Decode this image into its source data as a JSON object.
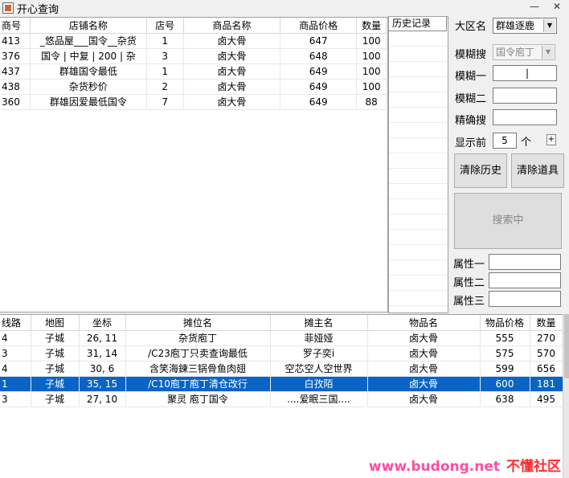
{
  "window": {
    "title": "开心查询",
    "minimize": "—",
    "close": "✕"
  },
  "top_table": {
    "columns": [
      "商号",
      "店铺名称",
      "店号",
      "商品名称",
      "商品价格",
      "数量"
    ],
    "rows": [
      [
        "413",
        "_悠品屋___国令__杂货",
        "1",
        "卤大骨",
        "647",
        "100"
      ],
      [
        "376",
        "国令 | 中复 | 200 | 杂",
        "3",
        "卤大骨",
        "648",
        "100"
      ],
      [
        "437",
        "群雄国令最低",
        "1",
        "卤大骨",
        "649",
        "100"
      ],
      [
        "438",
        "杂货秒价",
        "2",
        "卤大骨",
        "649",
        "100"
      ],
      [
        "360",
        "群雄因爱最低国令",
        "7",
        "卤大骨",
        "649",
        "88"
      ]
    ]
  },
  "history": {
    "header": "历史记录"
  },
  "panel": {
    "region_label": "大区名",
    "region_value": "群雄逐鹿",
    "fuzzy_search_label": "模糊搜",
    "fuzzy_search_value": "国令庖丁",
    "fuzzy1_label": "模糊一",
    "fuzzy1_value": "|",
    "fuzzy2_label": "模糊二",
    "fuzzy2_value": "",
    "exact_label": "精确搜",
    "exact_value": "",
    "show_top_label": "显示前",
    "show_top_value": "5",
    "show_top_unit": "个",
    "plus": "+",
    "clear_history": "清除历史",
    "clear_items": "清除道具",
    "searching": "搜索中",
    "attr1_label": "属性一",
    "attr2_label": "属性二",
    "attr3_label": "属性三"
  },
  "bottom_table": {
    "columns": [
      "线路",
      "地图",
      "坐标",
      "摊位名",
      "摊主名",
      "物品名",
      "物品价格",
      "数量"
    ],
    "selected_row": 3,
    "rows": [
      [
        "4",
        "子城",
        "26, 11",
        "杂货庖丁",
        "菲娅娅",
        "卤大骨",
        "555",
        "270"
      ],
      [
        "3",
        "子城",
        "31, 14",
        "/C23庖丁只卖查询最低",
        "罗子奕i",
        "卤大骨",
        "575",
        "570"
      ],
      [
        "4",
        "子城",
        "30, 6",
        "含笑海鍊三锅骨鱼肉翅",
        "空芯空人空世界",
        "卤大骨",
        "599",
        "656"
      ],
      [
        "1",
        "子城",
        "35, 15",
        "/C10庖丁庖丁清仓改行",
        "白孜陌",
        "卤大骨",
        "600",
        "181"
      ],
      [
        "3",
        "子城",
        "27, 10",
        "聚灵 庖丁国令",
        "....爱眠三国....",
        "卤大骨",
        "638",
        "495"
      ]
    ]
  },
  "watermark": {
    "url": "www.budong.net",
    "name": "不懂社区"
  }
}
